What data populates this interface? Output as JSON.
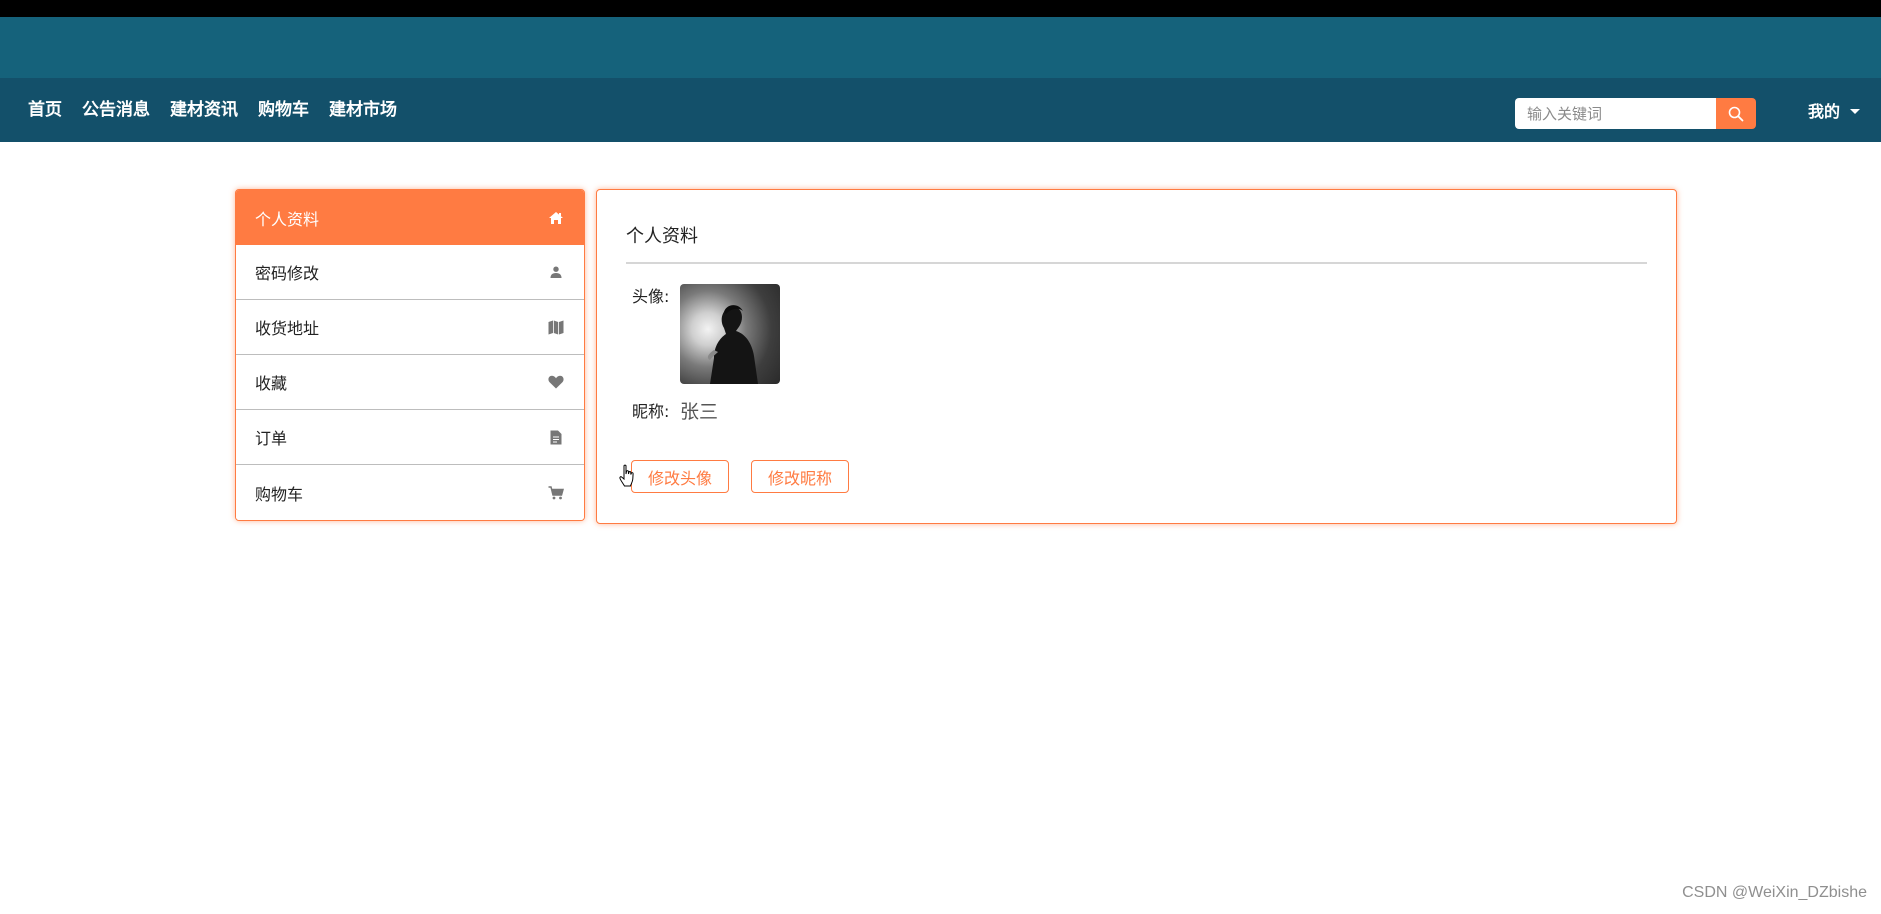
{
  "navbar": {
    "links": [
      "首页",
      "公告消息",
      "建材资讯",
      "购物车",
      "建材市场"
    ],
    "search_placeholder": "输入关键词",
    "search_icon": "search-icon",
    "my_menu_label": "我的"
  },
  "sidebar": {
    "items": [
      {
        "label": "个人资料",
        "icon": "home-icon",
        "active": true
      },
      {
        "label": "密码修改",
        "icon": "user-icon",
        "active": false
      },
      {
        "label": "收货地址",
        "icon": "map-icon",
        "active": false
      },
      {
        "label": "收藏",
        "icon": "heart-icon",
        "active": false
      },
      {
        "label": "订单",
        "icon": "document-icon",
        "active": false
      },
      {
        "label": "购物车",
        "icon": "cart-icon",
        "active": false
      }
    ]
  },
  "profile": {
    "title": "个人资料",
    "avatar_label": "头像:",
    "nickname_label": "昵称:",
    "nickname_value": "张三",
    "change_avatar_label": "修改头像",
    "change_nickname_label": "修改昵称"
  },
  "watermark": "CSDN @WeiXin_DZbishe",
  "colors": {
    "accent": "#ff7b42",
    "banner": "#15627b",
    "navbar": "#13506a"
  }
}
